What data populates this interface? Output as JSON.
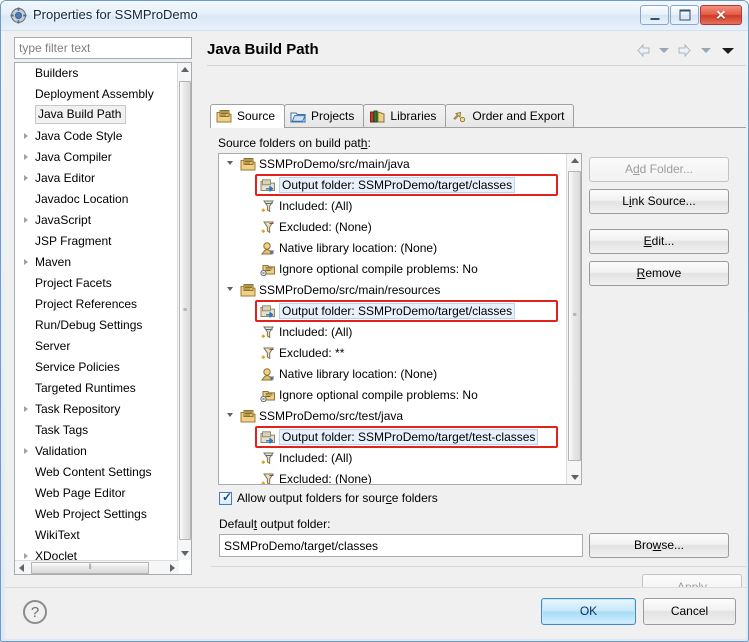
{
  "window": {
    "title": "Properties for SSMProDemo",
    "icon": "eclipse-properties-icon",
    "minimize_label": "Minimize",
    "maximize_label": "Maximize",
    "close_label": "✕"
  },
  "filter": {
    "value": "",
    "placeholder": "type filter text"
  },
  "sidebar": {
    "items": [
      {
        "label": "Builders",
        "expandable": false,
        "selected": false
      },
      {
        "label": "Deployment Assembly",
        "expandable": false,
        "selected": false
      },
      {
        "label": "Java Build Path",
        "expandable": false,
        "selected": true
      },
      {
        "label": "Java Code Style",
        "expandable": true,
        "selected": false
      },
      {
        "label": "Java Compiler",
        "expandable": true,
        "selected": false
      },
      {
        "label": "Java Editor",
        "expandable": true,
        "selected": false
      },
      {
        "label": "Javadoc Location",
        "expandable": false,
        "selected": false
      },
      {
        "label": "JavaScript",
        "expandable": true,
        "selected": false
      },
      {
        "label": "JSP Fragment",
        "expandable": false,
        "selected": false
      },
      {
        "label": "Maven",
        "expandable": true,
        "selected": false
      },
      {
        "label": "Project Facets",
        "expandable": false,
        "selected": false
      },
      {
        "label": "Project References",
        "expandable": false,
        "selected": false
      },
      {
        "label": "Run/Debug Settings",
        "expandable": false,
        "selected": false
      },
      {
        "label": "Server",
        "expandable": false,
        "selected": false
      },
      {
        "label": "Service Policies",
        "expandable": false,
        "selected": false
      },
      {
        "label": "Targeted Runtimes",
        "expandable": false,
        "selected": false
      },
      {
        "label": "Task Repository",
        "expandable": true,
        "selected": false
      },
      {
        "label": "Task Tags",
        "expandable": false,
        "selected": false
      },
      {
        "label": "Validation",
        "expandable": true,
        "selected": false
      },
      {
        "label": "Web Content Settings",
        "expandable": false,
        "selected": false
      },
      {
        "label": "Web Page Editor",
        "expandable": false,
        "selected": false
      },
      {
        "label": "Web Project Settings",
        "expandable": false,
        "selected": false
      },
      {
        "label": "WikiText",
        "expandable": false,
        "selected": false
      },
      {
        "label": "XDoclet",
        "expandable": true,
        "selected": false
      }
    ]
  },
  "page": {
    "title": "Java Build Path",
    "nav": {
      "back_icon": "back-arrow-icon",
      "back_menu_icon": "chevron-down-icon",
      "forward_icon": "forward-arrow-icon",
      "forward_menu_icon": "chevron-down-icon",
      "menu_icon": "chevron-down-icon"
    }
  },
  "tabs": [
    {
      "label": "Source",
      "icon": "source-folder-icon",
      "active": true
    },
    {
      "label": "Projects",
      "icon": "projects-folder-icon",
      "active": false
    },
    {
      "label": "Libraries",
      "icon": "libraries-books-icon",
      "active": false
    },
    {
      "label": "Order and Export",
      "icon": "order-export-icon",
      "active": false
    }
  ],
  "source_section": {
    "label_pre": "Source folders on build pat",
    "label_mnemonic": "h",
    "label_post": ":"
  },
  "build_path_tree": [
    {
      "level": 0,
      "text": "SSMProDemo/src/main/java",
      "icon": "source-folder-icon",
      "expanded": true,
      "highlighted": false
    },
    {
      "level": 1,
      "text": "Output folder: SSMProDemo/target/classes",
      "icon": "output-folder-icon",
      "expanded": false,
      "highlighted": true
    },
    {
      "level": 1,
      "text": "Included: (All)",
      "icon": "include-filter-icon",
      "expanded": false,
      "highlighted": false
    },
    {
      "level": 1,
      "text": "Excluded: (None)",
      "icon": "exclude-filter-icon",
      "expanded": false,
      "highlighted": false
    },
    {
      "level": 1,
      "text": "Native library location: (None)",
      "icon": "native-library-icon",
      "expanded": false,
      "highlighted": false
    },
    {
      "level": 1,
      "text": "Ignore optional compile problems: No",
      "icon": "compile-problems-icon",
      "expanded": false,
      "highlighted": false
    },
    {
      "level": 0,
      "text": "SSMProDemo/src/main/resources",
      "icon": "source-folder-icon",
      "expanded": true,
      "highlighted": false
    },
    {
      "level": 1,
      "text": "Output folder: SSMProDemo/target/classes",
      "icon": "output-folder-icon",
      "expanded": false,
      "highlighted": true
    },
    {
      "level": 1,
      "text": "Included: (All)",
      "icon": "include-filter-icon",
      "expanded": false,
      "highlighted": false
    },
    {
      "level": 1,
      "text": "Excluded: **",
      "icon": "exclude-filter-icon",
      "expanded": false,
      "highlighted": false
    },
    {
      "level": 1,
      "text": "Native library location: (None)",
      "icon": "native-library-icon",
      "expanded": false,
      "highlighted": false
    },
    {
      "level": 1,
      "text": "Ignore optional compile problems: No",
      "icon": "compile-problems-icon",
      "expanded": false,
      "highlighted": false
    },
    {
      "level": 0,
      "text": "SSMProDemo/src/test/java",
      "icon": "source-folder-icon",
      "expanded": true,
      "highlighted": false
    },
    {
      "level": 1,
      "text": "Output folder: SSMProDemo/target/test-classes",
      "icon": "output-folder-icon",
      "expanded": false,
      "highlighted": true
    },
    {
      "level": 1,
      "text": "Included: (All)",
      "icon": "include-filter-icon",
      "expanded": false,
      "highlighted": false
    },
    {
      "level": 1,
      "text": "Excluded: (None)",
      "icon": "exclude-filter-icon",
      "expanded": false,
      "highlighted": false
    }
  ],
  "side_buttons": [
    {
      "id": "add-folder",
      "pre": "A",
      "mnemonic": "d",
      "post": "d Folder...",
      "enabled": false
    },
    {
      "id": "link-source",
      "pre": "L",
      "mnemonic": "i",
      "post": "nk Source...",
      "enabled": true
    },
    {
      "id": "edit",
      "pre": "",
      "mnemonic": "E",
      "post": "dit...",
      "enabled": true
    },
    {
      "id": "remove",
      "pre": "",
      "mnemonic": "R",
      "post": "emove",
      "enabled": true
    }
  ],
  "allow_output": {
    "checked": true,
    "tick": "✓",
    "label_pre": "Allow output folders for sour",
    "label_mnemonic": "c",
    "label_post": "e folders"
  },
  "default_output": {
    "label_pre": "Defaul",
    "label_mnemonic": "t",
    "label_post": " output folder:",
    "value": "SSMProDemo/target/classes",
    "browse": {
      "pre": "Bro",
      "mnemonic": "w",
      "post": "se...",
      "enabled": true
    }
  },
  "apply_button": {
    "pre": "",
    "mnemonic": "A",
    "post": "pply",
    "enabled": false
  },
  "footer": {
    "help_icon": "help-question-icon",
    "help_glyph": "?",
    "ok_label": "OK",
    "cancel_label": "Cancel"
  },
  "colors": {
    "highlight_red": "#e2231a",
    "title_blue": "#10283d",
    "ok_accent": "#3c8bc4"
  }
}
